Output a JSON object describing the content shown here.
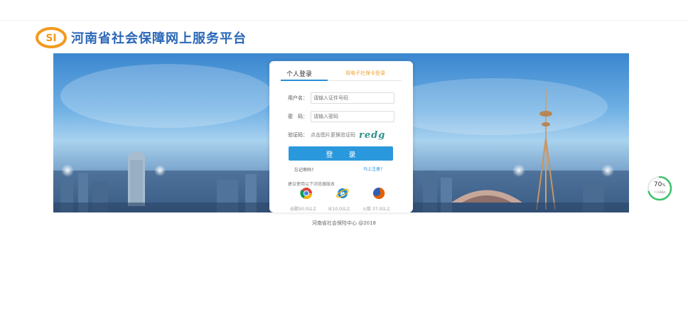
{
  "header": {
    "title": "河南省社会保障网上服务平台",
    "logo_text": "SI"
  },
  "login": {
    "tab_personal": "个人登录",
    "tab_card": "用电子社保卡登录",
    "username_label": "用户名：",
    "username_placeholder": "请输入证件号码",
    "password_label": "密　码：",
    "password_placeholder": "请输入密码",
    "captcha_label": "验证码：",
    "captcha_hint": "点击图片更换验证码",
    "captcha_text": "redg",
    "login_button": "登录",
    "forgot": "忘记密码?",
    "register": "马上注册?",
    "browser_hint": "建议使用以下浏览器版本",
    "browsers": [
      "谷歌50.0以上",
      "IE10.0以上",
      "火狐 37.0以上"
    ]
  },
  "footer": "河南省社会保险中心 @2018",
  "speed_widget": {
    "value": "70",
    "unit": "%",
    "rate": "↑ 0.6K/s",
    "progress": 0.7
  },
  "colors": {
    "brand": "#2a67b8",
    "accent": "#2a98dc",
    "card_tab": "#f0a030",
    "logo": "#f29a1e"
  }
}
